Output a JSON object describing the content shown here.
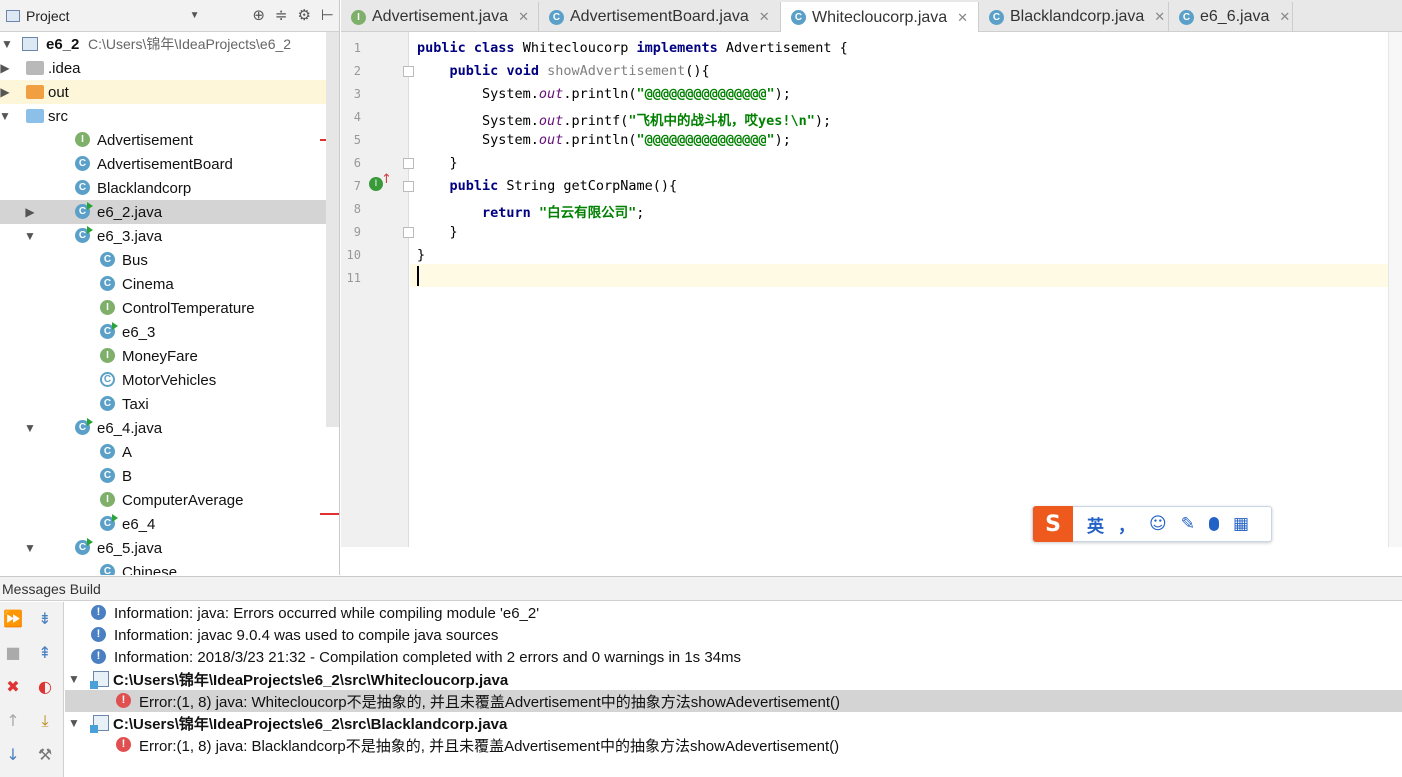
{
  "project_panel": {
    "title": "Project",
    "root": {
      "name": "e6_2",
      "path": "C:\\Users\\锦年\\IdeaProjects\\e6_2"
    },
    "tree": [
      {
        "label": ".idea",
        "icon": "folder-icon",
        "depth": 1,
        "arrow": "right"
      },
      {
        "label": "out",
        "icon": "folder-orange-icon",
        "depth": 1,
        "arrow": "right",
        "highlight": true
      },
      {
        "label": "src",
        "icon": "folder-blue-icon",
        "depth": 1,
        "arrow": "down"
      },
      {
        "label": "Advertisement",
        "icon": "interface-icon",
        "depth": 2
      },
      {
        "label": "AdvertisementBoard",
        "icon": "class-icon",
        "depth": 2
      },
      {
        "label": "Blacklandcorp",
        "icon": "class-icon",
        "depth": 2
      },
      {
        "label": "e6_2.java",
        "icon": "runnable-class-icon",
        "depth": 2,
        "arrow": "right",
        "selected": true
      },
      {
        "label": "e6_3.java",
        "icon": "runnable-class-icon",
        "depth": 2,
        "arrow": "down"
      },
      {
        "label": "Bus",
        "icon": "class-icon",
        "depth": 3
      },
      {
        "label": "Cinema",
        "icon": "class-icon",
        "depth": 3
      },
      {
        "label": "ControlTemperature",
        "icon": "interface-icon",
        "depth": 3
      },
      {
        "label": "e6_3",
        "icon": "runnable-class-icon",
        "depth": 3
      },
      {
        "label": "MoneyFare",
        "icon": "interface-icon",
        "depth": 3
      },
      {
        "label": "MotorVehicles",
        "icon": "abstract-class-icon",
        "depth": 3
      },
      {
        "label": "Taxi",
        "icon": "class-icon",
        "depth": 3
      },
      {
        "label": "e6_4.java",
        "icon": "runnable-class-icon",
        "depth": 2,
        "arrow": "down"
      },
      {
        "label": "A",
        "icon": "class-icon",
        "depth": 3
      },
      {
        "label": "B",
        "icon": "class-icon",
        "depth": 3
      },
      {
        "label": "ComputerAverage",
        "icon": "interface-icon",
        "depth": 3
      },
      {
        "label": "e6_4",
        "icon": "runnable-class-icon",
        "depth": 3
      },
      {
        "label": "e6_5.java",
        "icon": "runnable-class-icon",
        "depth": 2,
        "arrow": "down"
      },
      {
        "label": "Chinese",
        "icon": "class-icon",
        "depth": 3
      }
    ]
  },
  "tabs": [
    {
      "label": "Advertisement.java",
      "icon": "interface-icon"
    },
    {
      "label": "AdvertisementBoard.java",
      "icon": "class-icon"
    },
    {
      "label": "Whitecloucorp.java",
      "icon": "class-icon",
      "active": true
    },
    {
      "label": "Blacklandcorp.java",
      "icon": "class-icon"
    },
    {
      "label": "e6_6.java",
      "icon": "runnable-class-icon"
    }
  ],
  "editor": {
    "line_numbers": [
      "1",
      "2",
      "3",
      "4",
      "5",
      "6",
      "7",
      "8",
      "9",
      "10",
      "11"
    ],
    "lines": [
      "public class Whitecloucorp implements Advertisement {",
      "    public void showAdvertisement(){",
      "        System.out.println(\"@@@@@@@@@@@@@@@\");",
      "        System.out.printf(\"飞机中的战斗机，哎yes!\\n\");",
      "        System.out.println(\"@@@@@@@@@@@@@@@\");",
      "    }",
      "    public String getCorpName(){",
      "        return \"白云有限公司\";",
      "    }",
      "}",
      ""
    ]
  },
  "ime": {
    "items": [
      "英",
      "，",
      "☺",
      "✎",
      "🎤",
      "▦"
    ]
  },
  "messages": {
    "title": "Messages Build",
    "rows": [
      {
        "type": "info",
        "text": "Information: java: Errors occurred while compiling module 'e6_2'"
      },
      {
        "type": "info",
        "text": "Information: javac 9.0.4 was used to compile java sources"
      },
      {
        "type": "info",
        "text": "Information: 2018/3/23 21:32 - Compilation completed with 2 errors and 0 warnings in 1s 34ms"
      },
      {
        "type": "file",
        "text": "C:\\Users\\锦年\\IdeaProjects\\e6_2\\src\\Whitecloucorp.java"
      },
      {
        "type": "error",
        "text": "Error:(1, 8)  java: Whitecloucorp不是抽象的, 并且未覆盖Advertisement中的抽象方法showAdevertisement()",
        "selected": true
      },
      {
        "type": "file",
        "text": "C:\\Users\\锦年\\IdeaProjects\\e6_2\\src\\Blacklandcorp.java"
      },
      {
        "type": "error",
        "text": "Error:(1, 8)  java: Blacklandcorp不是抽象的, 并且未覆盖Advertisement中的抽象方法showAdevertisement()"
      }
    ]
  },
  "colors": {
    "class_icon": "#5aa0c8",
    "interface_icon": "#7eb06a",
    "error": "#e05050",
    "info": "#4a7fc1",
    "keyword": "#000080",
    "string": "#008000"
  }
}
